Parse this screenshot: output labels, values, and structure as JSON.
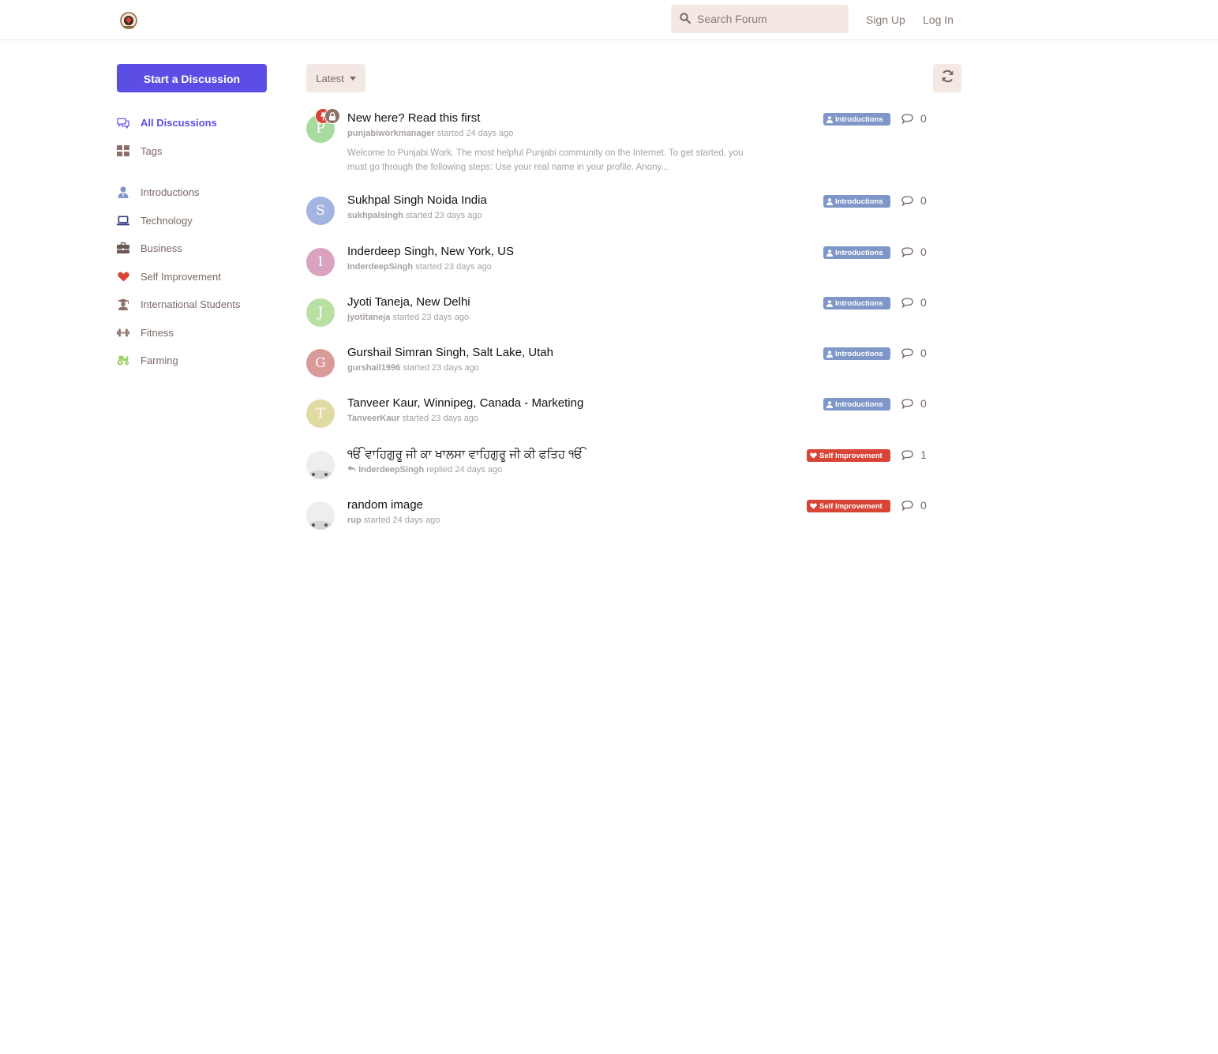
{
  "header": {
    "search_placeholder": "Search Forum",
    "signup_label": "Sign Up",
    "login_label": "Log In"
  },
  "sidebar": {
    "start_button": "Start a Discussion",
    "primary": [
      {
        "label": "All Discussions",
        "icon": "comments-icon",
        "active": true
      },
      {
        "label": "Tags",
        "icon": "tags-grid-icon"
      }
    ],
    "tags": [
      {
        "label": "Introductions",
        "icon": "user-tie-icon",
        "color": "#7f97c8"
      },
      {
        "label": "Technology",
        "icon": "laptop-icon",
        "color": "#3a3f85"
      },
      {
        "label": "Business",
        "icon": "briefcase-icon",
        "color": "#6b5753"
      },
      {
        "label": "Self Improvement",
        "icon": "heart-icon",
        "color": "#d84536"
      },
      {
        "label": "International Students",
        "icon": "graduation-cap-icon",
        "color": "#8e6f69"
      },
      {
        "label": "Fitness",
        "icon": "dumbbell-icon",
        "color": "#8e6f69"
      },
      {
        "label": "Farming",
        "icon": "tractor-icon",
        "color": "#9ad163"
      }
    ]
  },
  "toolbar": {
    "sort_label": "Latest"
  },
  "discussions": [
    {
      "title": "New here? Read this first",
      "user": "punjabiworkmanager",
      "action": "started 24 days ago",
      "excerpt": "Welcome to Punjabi.Work. The most helpful Punjabi community on the Internet. To get started, you must go through the following steps: Use your real name in your profile. Anony...",
      "avatar_letter": "P",
      "avatar_color": "#a8dba0",
      "tag": "Introductions",
      "replies": "0"
    },
    {
      "title": "Sukhpal Singh Noida India",
      "user": "sukhpalsingh",
      "action": "started 23 days ago",
      "avatar_letter": "S",
      "avatar_color": "#a3b4e0",
      "tag": "Introductions",
      "replies": "0"
    },
    {
      "title": "Inderdeep Singh, New York, US",
      "user": "InderdeepSingh",
      "action": "started 23 days ago",
      "avatar_letter": "I",
      "avatar_color": "#d9a3bf",
      "tag": "Introductions",
      "replies": "0"
    },
    {
      "title": "Jyoti Taneja, New Delhi",
      "user": "jyotitaneja",
      "action": "started 23 days ago",
      "avatar_letter": "J",
      "avatar_color": "#b9e0a3",
      "tag": "Introductions",
      "replies": "0"
    },
    {
      "title": "Gurshail Simran Singh, Salt Lake, Utah",
      "user": "gurshail1996",
      "action": "started 23 days ago",
      "avatar_letter": "G",
      "avatar_color": "#d99a9a",
      "tag": "Introductions",
      "replies": "0"
    },
    {
      "title": "Tanveer Kaur, Winnipeg, Canada - Marketing",
      "user": "TanveerKaur",
      "action": "started 23 days ago",
      "avatar_letter": "T",
      "avatar_color": "#e0dba3",
      "tag": "Introductions",
      "replies": "0"
    },
    {
      "title": "ੴ ਵਾਹਿਗੁਰੂ ਜੀ ਕਾ ਖਾਲਸਾ ਵਾਹਿਗੁਰੂ ਜੀ ਕੀ ਫਤਿਹ ੴ",
      "user": "InderdeepSingh",
      "action": "replied 24 days ago",
      "avatar_letter": "",
      "avatar_color": "#ececec",
      "tag": "Self Improvement",
      "replies": "1"
    },
    {
      "title": "random image",
      "user": "rup",
      "action": "started 24 days ago",
      "avatar_letter": "",
      "avatar_color": "#ececec",
      "tag": "Self Improvement",
      "replies": "0"
    }
  ]
}
